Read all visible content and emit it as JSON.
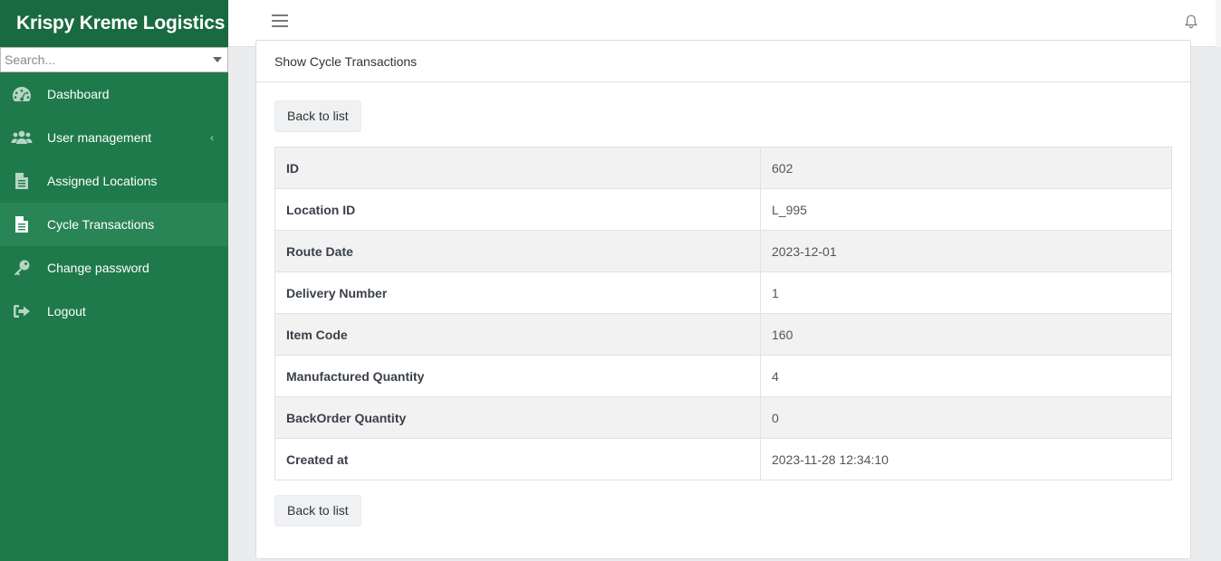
{
  "app": {
    "brand": "Krispy Kreme Logistics"
  },
  "sidebar": {
    "search_placeholder": "Search...",
    "items": [
      {
        "label": "Dashboard",
        "icon": "dashboard-icon",
        "active": false
      },
      {
        "label": "User management",
        "icon": "users-icon",
        "active": false,
        "has_submenu": true
      },
      {
        "label": "Assigned Locations",
        "icon": "file-icon",
        "active": false
      },
      {
        "label": "Cycle Transactions",
        "icon": "file-icon",
        "active": true
      },
      {
        "label": "Change password",
        "icon": "key-icon",
        "active": false
      },
      {
        "label": "Logout",
        "icon": "logout-icon",
        "active": false
      }
    ],
    "submenu_chevron": "‹"
  },
  "topbar": {
    "menu_icon": "hamburger-icon",
    "notification_icon": "bell-icon"
  },
  "card": {
    "title": "Show Cycle Transactions",
    "back_label": "Back to list",
    "rows": [
      {
        "key": "ID",
        "value": "602"
      },
      {
        "key": "Location ID",
        "value": "L_995"
      },
      {
        "key": "Route Date",
        "value": "2023-12-01"
      },
      {
        "key": "Delivery Number",
        "value": "1"
      },
      {
        "key": "Item Code",
        "value": "160"
      },
      {
        "key": "Manufactured Quantity",
        "value": "4"
      },
      {
        "key": "BackOrder Quantity",
        "value": "0"
      },
      {
        "key": "Created at",
        "value": "2023-11-28 12:34:10"
      }
    ]
  },
  "colors": {
    "sidebar_bg": "#1f7a4b",
    "brand_bg": "#196a40",
    "active_item_bg": "#2a8556"
  }
}
